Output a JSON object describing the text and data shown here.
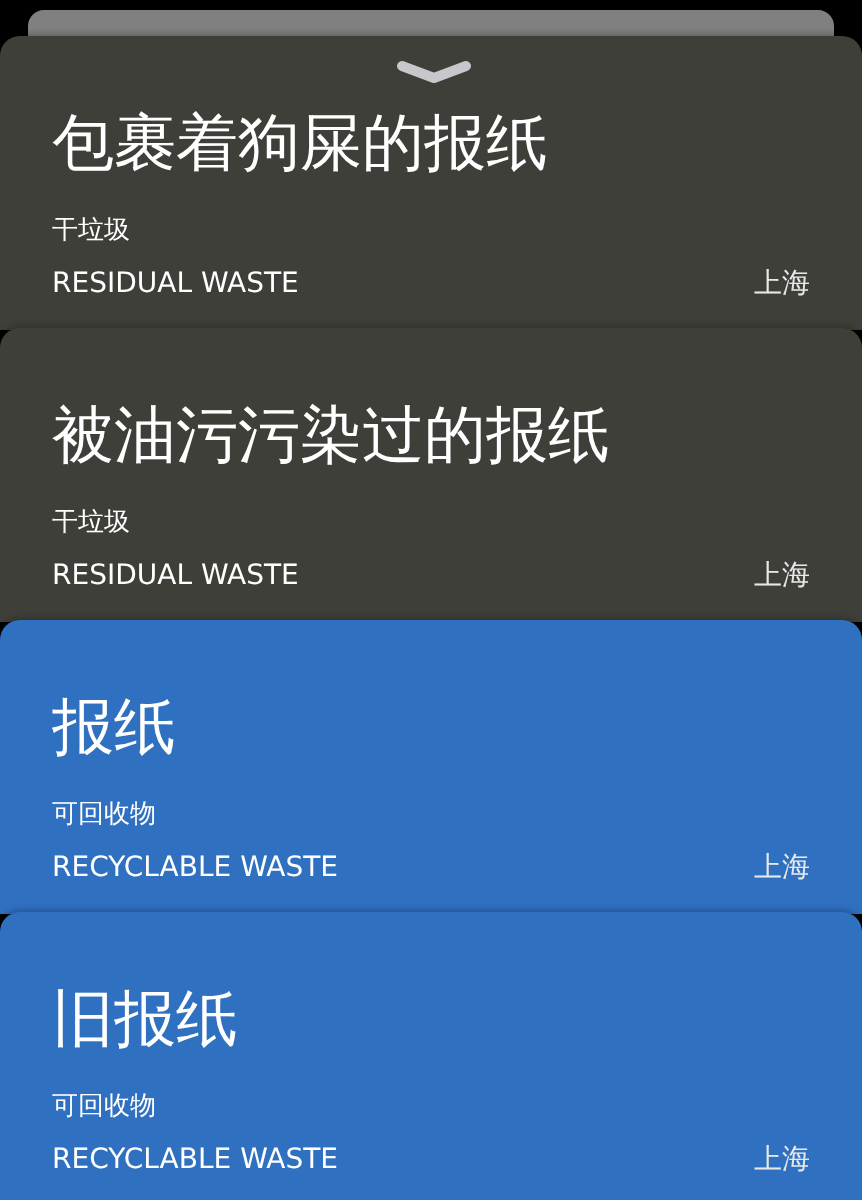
{
  "cards": [
    {
      "kind": "residual",
      "title": "包裹着狗屎的报纸",
      "category": "干垃圾",
      "category_en": "RESIDUAL WASTE",
      "city": "上海"
    },
    {
      "kind": "residual",
      "title": "被油污污染过的报纸",
      "category": "干垃圾",
      "category_en": "RESIDUAL WASTE",
      "city": "上海"
    },
    {
      "kind": "recyclable",
      "title": "报纸",
      "category": "可回收物",
      "category_en": "RECYCLABLE WASTE",
      "city": "上海"
    },
    {
      "kind": "recyclable",
      "title": "旧报纸",
      "category": "可回收物",
      "category_en": "RECYCLABLE WASTE",
      "city": "上海"
    }
  ]
}
